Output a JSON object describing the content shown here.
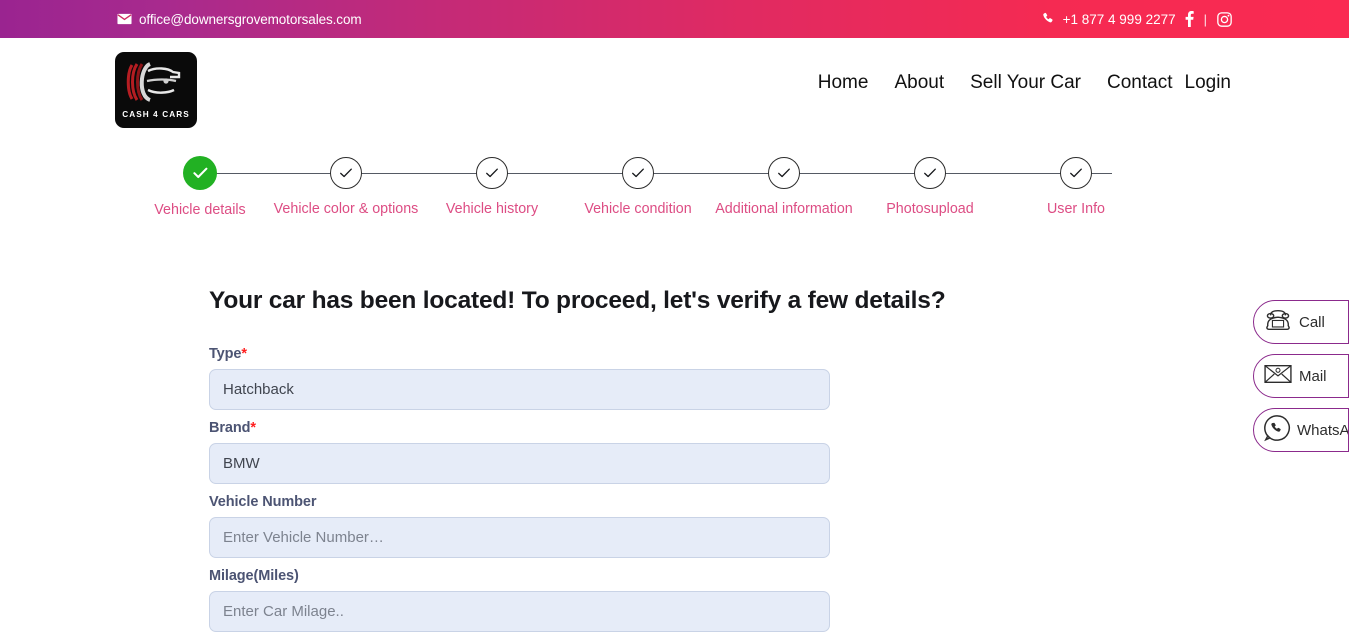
{
  "topbar": {
    "email": "office@downersgrovemotorsales.com",
    "phone": "+1 877 4 999 2277",
    "separator": "|",
    "email_icon": "envelope-icon",
    "phone_icon": "phone-icon",
    "facebook_icon": "facebook-icon",
    "instagram_icon": "instagram-icon",
    "gradient_from": "#9a2490",
    "gradient_to": "#fa2a52"
  },
  "header": {
    "logo_text": "CASH 4 CARS",
    "nav": [
      {
        "label": "Home"
      },
      {
        "label": "About"
      },
      {
        "label": "Sell Your Car"
      },
      {
        "label": "Contact"
      },
      {
        "label": "Login"
      }
    ]
  },
  "stepper": {
    "active_color": "#22b123",
    "label_color": "#dd4d84",
    "steps": [
      {
        "label": "Vehicle details",
        "state": "done"
      },
      {
        "label": "Vehicle color & options",
        "state": "pending"
      },
      {
        "label": "Vehicle history",
        "state": "pending"
      },
      {
        "label": "Vehicle condition",
        "state": "pending"
      },
      {
        "label": "Additional information",
        "state": "pending"
      },
      {
        "label": "Photosupload",
        "state": "pending"
      },
      {
        "label": "User Info",
        "state": "pending"
      }
    ]
  },
  "form": {
    "title": "Your car has been located! To proceed, let's verify a few details?",
    "required_marker": "*",
    "fields": [
      {
        "label": "Type",
        "required": true,
        "value": "Hatchback",
        "placeholder": ""
      },
      {
        "label": "Brand",
        "required": true,
        "value": "BMW",
        "placeholder": ""
      },
      {
        "label": "Vehicle Number",
        "required": false,
        "value": "",
        "placeholder": "Enter Vehicle Number…"
      },
      {
        "label": "Milage(Miles)",
        "required": false,
        "value": "",
        "placeholder": "Enter Car Milage.."
      }
    ]
  },
  "float_buttons": [
    {
      "icon": "telephone-icon",
      "label": "Call"
    },
    {
      "icon": "mail-icon",
      "label": "Mail"
    },
    {
      "icon": "whatsapp-icon",
      "label": "WhatsApp"
    }
  ]
}
